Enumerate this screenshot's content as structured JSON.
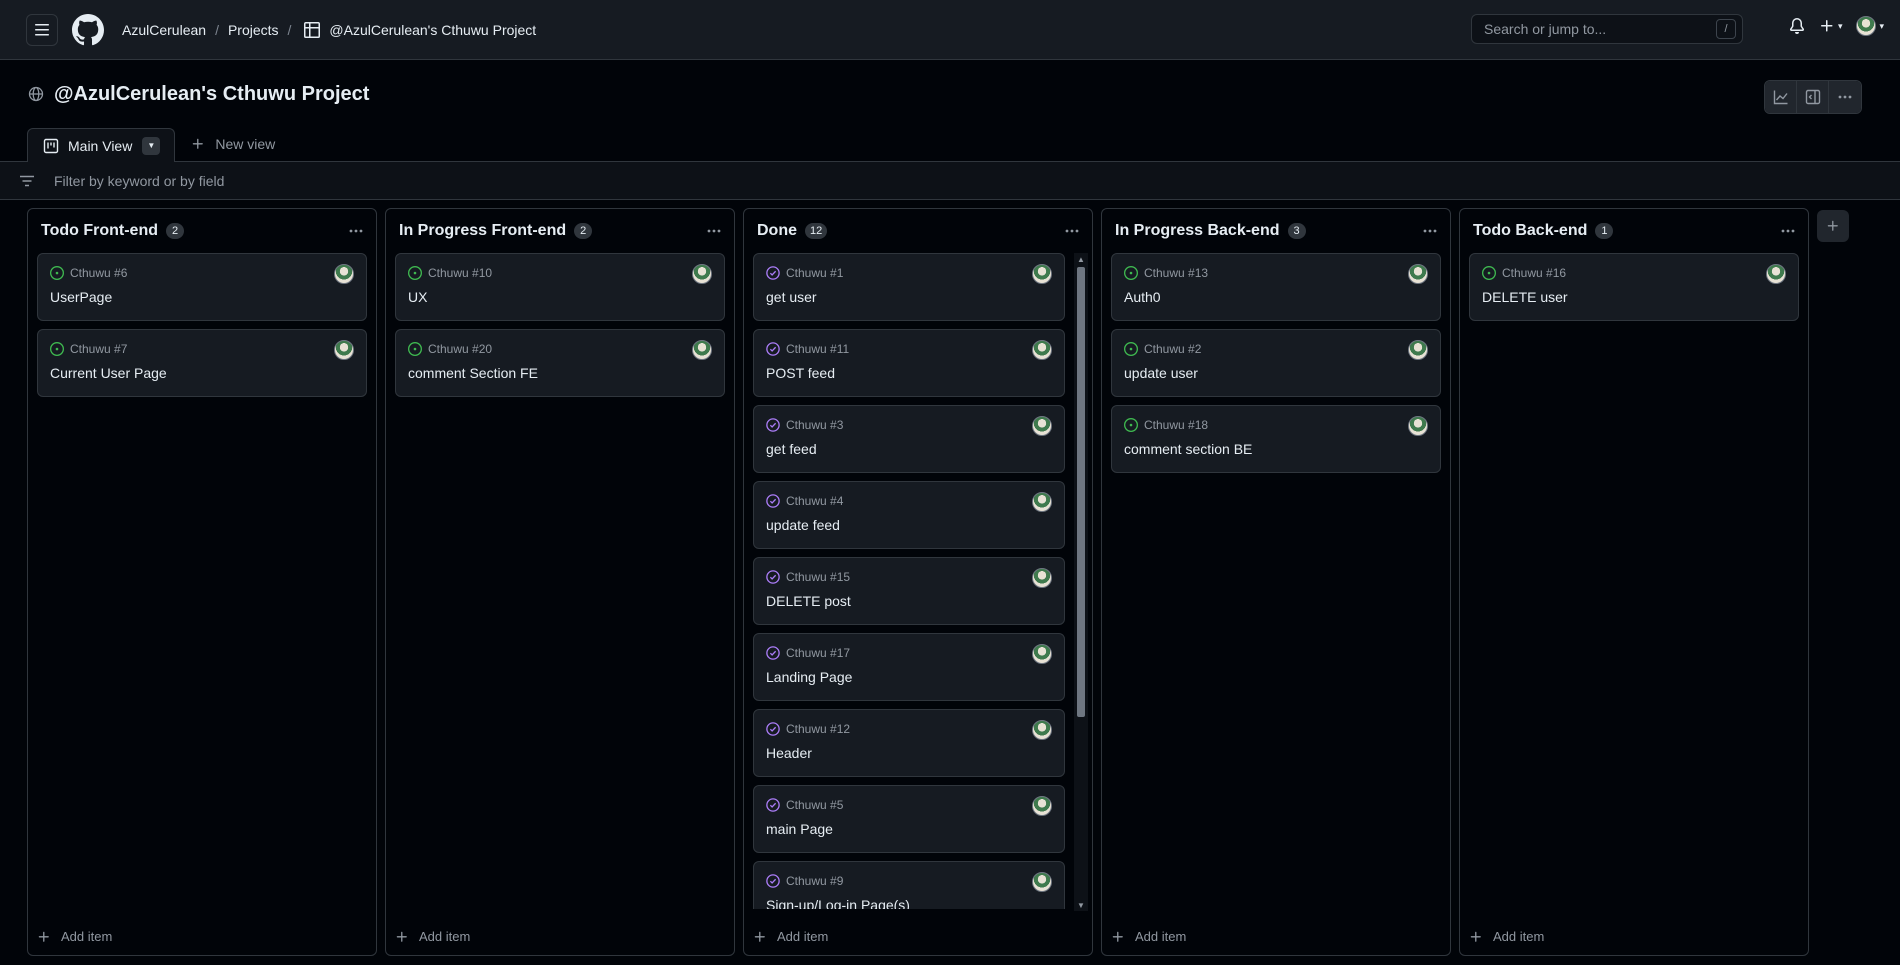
{
  "header": {
    "breadcrumbs": [
      "AzulCerulean",
      "Projects",
      "@AzulCerulean's Cthuwu Project"
    ],
    "separator": "/",
    "search_placeholder": "Search or jump to...",
    "search_shortcut": "/",
    "create_caret": "▾",
    "avatar_caret": "▾"
  },
  "project": {
    "title": "@AzulCerulean's Cthuwu Project"
  },
  "views": {
    "main_label": "Main View",
    "new_label": "New view"
  },
  "filter": {
    "placeholder": "Filter by keyword or by field"
  },
  "add_item_label": "Add item",
  "columns": [
    {
      "title": "Todo Front-end",
      "count": "2",
      "cards": [
        {
          "ref": "Cthuwu #6",
          "title": "UserPage",
          "state": "open"
        },
        {
          "ref": "Cthuwu #7",
          "title": "Current User Page",
          "state": "open"
        }
      ]
    },
    {
      "title": "In Progress Front-end",
      "count": "2",
      "cards": [
        {
          "ref": "Cthuwu #10",
          "title": "UX",
          "state": "open"
        },
        {
          "ref": "Cthuwu #20",
          "title": "comment Section FE",
          "state": "open"
        }
      ]
    },
    {
      "title": "Done",
      "count": "12",
      "cards": [
        {
          "ref": "Cthuwu #1",
          "title": "get user",
          "state": "done"
        },
        {
          "ref": "Cthuwu #11",
          "title": "POST feed",
          "state": "done"
        },
        {
          "ref": "Cthuwu #3",
          "title": "get feed",
          "state": "done"
        },
        {
          "ref": "Cthuwu #4",
          "title": "update feed",
          "state": "done"
        },
        {
          "ref": "Cthuwu #15",
          "title": "DELETE post",
          "state": "done"
        },
        {
          "ref": "Cthuwu #17",
          "title": "Landing Page",
          "state": "done"
        },
        {
          "ref": "Cthuwu #12",
          "title": "Header",
          "state": "done"
        },
        {
          "ref": "Cthuwu #5",
          "title": "main Page",
          "state": "done"
        },
        {
          "ref": "Cthuwu #9",
          "title": "Sign-up/Log-in Page(s)",
          "state": "done"
        }
      ]
    },
    {
      "title": "In Progress Back-end",
      "count": "3",
      "cards": [
        {
          "ref": "Cthuwu #13",
          "title": "Auth0",
          "state": "open"
        },
        {
          "ref": "Cthuwu #2",
          "title": "update user",
          "state": "open"
        },
        {
          "ref": "Cthuwu #18",
          "title": "comment section BE",
          "state": "open"
        }
      ]
    },
    {
      "title": "Todo Back-end",
      "count": "1",
      "cards": [
        {
          "ref": "Cthuwu #16",
          "title": "DELETE user",
          "state": "open"
        }
      ]
    }
  ],
  "colors": {
    "open_issue": "#3fb950",
    "closed_issue": "#ab7df8",
    "card_bg": "#161b22",
    "border": "#30363d"
  }
}
